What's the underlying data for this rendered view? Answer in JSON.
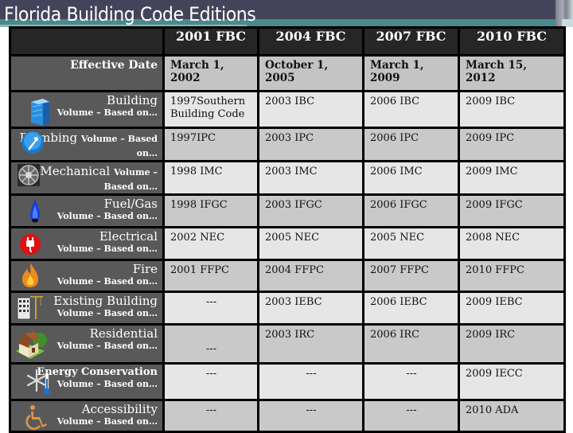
{
  "slide": {
    "title": "Florida Building Code Editions"
  },
  "table": {
    "columns": [
      "2001 FBC",
      "2004 FBC",
      "2007 FBC",
      "2010 FBC"
    ],
    "effective_date": {
      "label": "Effective Date",
      "values": [
        "March 1, 2002",
        "October 1, 2005",
        "March 1, 2009",
        "March 15, 2012"
      ]
    },
    "rows": [
      {
        "name": "Building",
        "sub": "Volume – Based on…",
        "icon": "building-icon",
        "values": [
          "1997Southern Building Code",
          "2003 IBC",
          "2006 IBC",
          "2009 IBC"
        ]
      },
      {
        "name": "Plumbing",
        "sub": "Volume – Based on…",
        "icon": "plumbing-wrench-icon",
        "values": [
          "1997IPC",
          "2003 IPC",
          "2006 IPC",
          "2009 IPC"
        ]
      },
      {
        "name": "Mechanical",
        "sub": "Volume – Based on…",
        "icon": "fan-icon",
        "values": [
          "1998 IMC",
          "2003 IMC",
          "2006 IMC",
          "2009 IMC"
        ]
      },
      {
        "name": "Fuel/Gas",
        "sub": "Volume – Based on…",
        "icon": "gas-flame-icon",
        "values": [
          "1998 IFGC",
          "2003 IFGC",
          "2006 IFGC",
          "2009 IFGC"
        ]
      },
      {
        "name": "Electrical",
        "sub": "Volume – Based on…",
        "icon": "electric-plug-icon",
        "values": [
          "2002 NEC",
          "2005 NEC",
          "2005 NEC",
          "2008 NEC"
        ]
      },
      {
        "name": "Fire",
        "sub": "Volume – Based on…",
        "icon": "fire-icon",
        "values": [
          "2001 FFPC",
          "2004 FFPC",
          "2007 FFPC",
          "2010 FFPC"
        ]
      },
      {
        "name": "Existing Building",
        "sub": "Volume – Based on…",
        "icon": "construction-building-icon",
        "values": [
          "---",
          "2003 IEBC",
          "2006 IEBC",
          "2009 IEBC"
        ]
      },
      {
        "name": "Residential",
        "sub": "Volume – Based on…",
        "icon": "house-icon",
        "values": [
          "---",
          "2003 IRC",
          "2006 IRC",
          "2009 IRC"
        ]
      },
      {
        "name": "Energy Conservation",
        "sub": "Volume – Based on…",
        "icon": "snowflake-thermometer-icon",
        "values": [
          "---",
          "---",
          "---",
          "2009 IECC"
        ]
      },
      {
        "name": "Accessibility",
        "sub": "Volume – Based on…",
        "icon": "wheelchair-icon",
        "values": [
          "---",
          "---",
          "---",
          "2010 ADA"
        ]
      }
    ]
  }
}
